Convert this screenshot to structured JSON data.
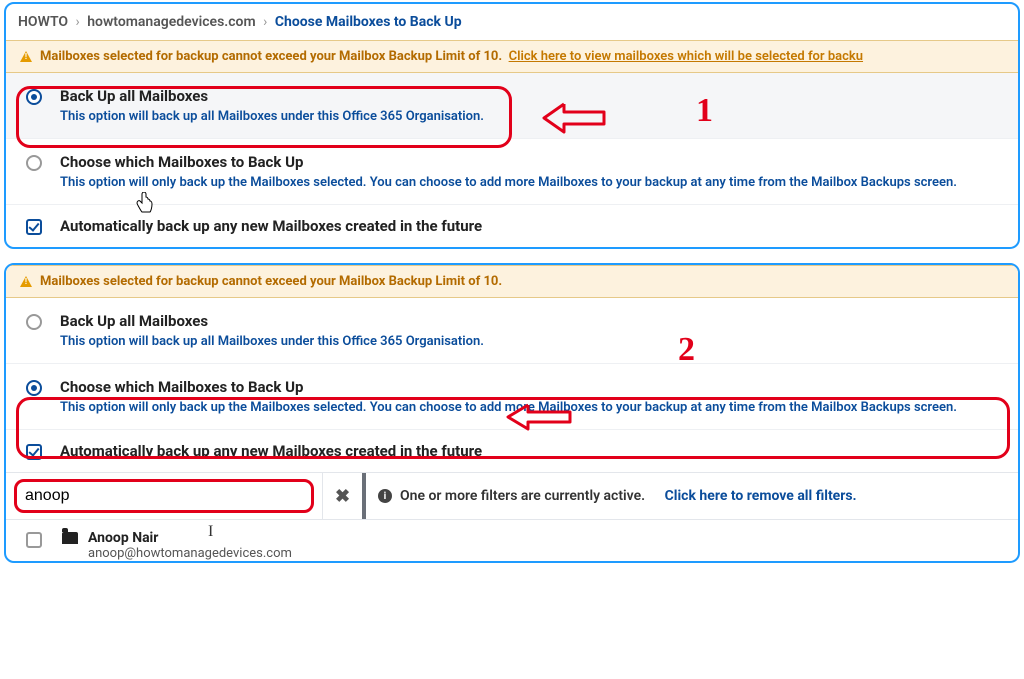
{
  "breadcrumb": {
    "items": [
      "HOWTO",
      "howtomanagedevices.com"
    ],
    "current": "Choose Mailboxes to Back Up"
  },
  "alert": {
    "text_main": "Mailboxes selected for backup cannot exceed your Mailbox Backup Limit of 10.",
    "link_text": "Click here to view mailboxes which will be selected for backu"
  },
  "options": {
    "all": {
      "title": "Back Up all Mailboxes",
      "desc": "This option will back up all Mailboxes under this Office 365 Organisation."
    },
    "choose": {
      "title": "Choose which Mailboxes to Back Up",
      "desc": "This option will only back up the Mailboxes selected. You can choose to add more Mailboxes to your backup at any time from the Mailbox Backups screen."
    },
    "auto": {
      "title": "Automatically back up any new Mailboxes created in the future"
    }
  },
  "filter": {
    "value": "anoop",
    "msg": "One or more filters are currently active.",
    "link": "Click here to remove all filters."
  },
  "result": {
    "name": "Anoop Nair",
    "email": "anoop@howtomanagedevices.com"
  },
  "annotations": {
    "one": "1",
    "two": "2"
  }
}
